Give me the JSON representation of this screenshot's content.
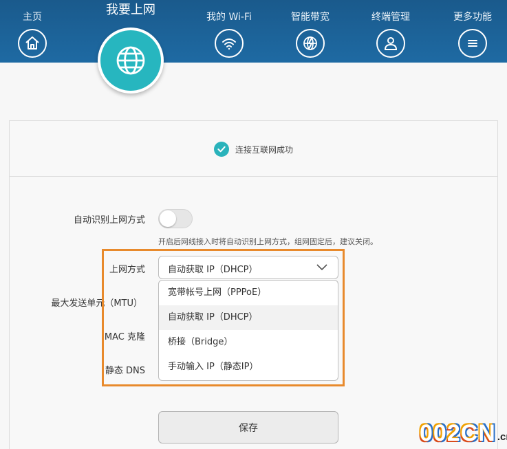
{
  "nav": {
    "home_label": "主页",
    "internet_label": "我要上网",
    "wifi_label": "我的 Wi-Fi",
    "bandwidth_label": "智能带宽",
    "devices_label": "终端管理",
    "more_label": "更多功能",
    "icons": [
      "home-icon",
      "globe-icon",
      "wifi-icon",
      "globe-lightning-icon",
      "user-icon",
      "menu-icon"
    ]
  },
  "status": {
    "text": "连接互联网成功",
    "icon": "check-icon"
  },
  "form": {
    "auto_detect_label": "自动识别上网方式",
    "auto_detect_on": false,
    "auto_detect_hint": "开启后网线接入时将自动识别上网方式，组网固定后，建议关闭。",
    "mode_label": "上网方式",
    "mode_value": "自动获取 IP（DHCP）",
    "mode_options": [
      "宽带帐号上网（PPPoE）",
      "自动获取 IP（DHCP）",
      "桥接（Bridge）",
      "手动输入 IP（静态IP）"
    ],
    "mtu_label": "最大发送单元（MTU）",
    "mac_label": "MAC 克隆",
    "dns_label": "静态 DNS",
    "save_label": "保存"
  },
  "watermark": {
    "text": "002CN",
    "suffix": ".cn"
  },
  "colors": {
    "nav_bg": "#1e6aa3",
    "accent_teal": "#27b6bf",
    "highlight_orange": "#e88a2c"
  }
}
